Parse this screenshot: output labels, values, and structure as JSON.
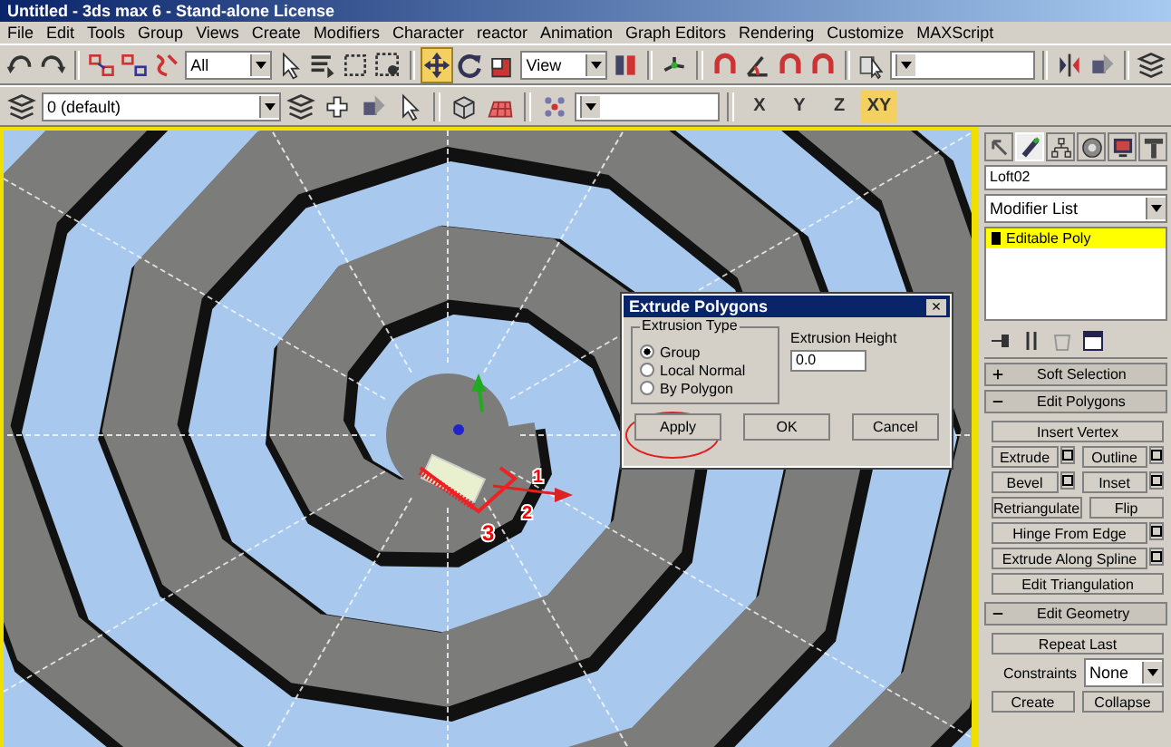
{
  "window": {
    "title": "Untitled - 3ds max 6 - Stand-alone License"
  },
  "menu": [
    "File",
    "Edit",
    "Tools",
    "Group",
    "Views",
    "Create",
    "Modifiers",
    "Character",
    "reactor",
    "Animation",
    "Graph Editors",
    "Rendering",
    "Customize",
    "MAXScript"
  ],
  "toolbar_1": [
    {
      "kind": "undo",
      "selected": false
    },
    {
      "kind": "redo",
      "selected": false
    },
    {
      "kind": "sep"
    },
    {
      "kind": "link",
      "selected": false
    },
    {
      "kind": "unlink",
      "selected": false
    },
    {
      "kind": "bind",
      "selected": false
    },
    {
      "kind": "dropdown",
      "value": "All"
    },
    {
      "kind": "select",
      "selected": false
    },
    {
      "kind": "list",
      "selected": false
    },
    {
      "kind": "region",
      "selected": false
    },
    {
      "kind": "window",
      "selected": false
    },
    {
      "kind": "sep"
    },
    {
      "kind": "move",
      "selected": true
    },
    {
      "kind": "rotate",
      "selected": false
    },
    {
      "kind": "scale",
      "selected": false
    },
    {
      "kind": "dropdown",
      "value": "View"
    },
    {
      "kind": "pivot",
      "selected": false
    },
    {
      "kind": "sep"
    },
    {
      "kind": "manipulate",
      "selected": false
    },
    {
      "kind": "sep"
    },
    {
      "kind": "magnet",
      "selected": false
    },
    {
      "kind": "angle",
      "selected": false
    },
    {
      "kind": "magnet",
      "selected": false
    },
    {
      "kind": "magnet",
      "selected": false
    },
    {
      "kind": "sep"
    },
    {
      "kind": "named",
      "selected": false
    },
    {
      "kind": "dropdown"
    },
    {
      "kind": "sep"
    },
    {
      "kind": "mirror",
      "selected": false
    },
    {
      "kind": "align",
      "selected": false
    },
    {
      "kind": "sep"
    },
    {
      "kind": "layers",
      "selected": false
    }
  ],
  "toolbar_2": [
    {
      "kind": "layers",
      "selected": false
    },
    {
      "kind": "dropdown",
      "value": "0 (default)"
    },
    {
      "kind": "layers",
      "selected": false
    },
    {
      "kind": "plus",
      "selected": false
    },
    {
      "kind": "align",
      "selected": false
    },
    {
      "kind": "select",
      "selected": false
    },
    {
      "kind": "sep"
    },
    {
      "kind": "teapot",
      "selected": false
    },
    {
      "kind": "grid",
      "selected": false
    },
    {
      "kind": "sep"
    },
    {
      "kind": "dots",
      "selected": false
    },
    {
      "kind": "dropdown"
    },
    {
      "kind": "sep"
    },
    {
      "kind": "axis",
      "label": "X",
      "selected": false
    },
    {
      "kind": "axis",
      "label": "Y",
      "selected": false
    },
    {
      "kind": "axis",
      "label": "Z",
      "selected": false
    },
    {
      "kind": "axis",
      "label": "XY",
      "selected": true
    }
  ],
  "viewport": {
    "gizmo_labels": [
      "1",
      "2",
      "3"
    ]
  },
  "dialog": {
    "title": "Extrude Polygons",
    "close": "×",
    "group_title": "Extrusion Type",
    "extrusion_types": [
      {
        "label": "Group",
        "selected": true
      },
      {
        "label": "Local Normal",
        "selected": false
      },
      {
        "label": "By Polygon",
        "selected": false
      }
    ],
    "height_label": "Extrusion Height",
    "height_value": "0.0",
    "buttons": [
      "Apply",
      "OK",
      "Cancel"
    ]
  },
  "command_panel": {
    "tabs": [
      {
        "kind": "create",
        "selected": false
      },
      {
        "kind": "modify",
        "selected": true
      },
      {
        "kind": "hierarchy",
        "selected": false
      },
      {
        "kind": "motion",
        "selected": false
      },
      {
        "kind": "display",
        "selected": false
      },
      {
        "kind": "utilities",
        "selected": false
      }
    ],
    "object_name": "Loft02",
    "modifier_list": "Modifier List",
    "stack": [
      {
        "label": "Editable Poly",
        "selected": true
      }
    ],
    "rollouts": [
      {
        "title": "Soft Selection",
        "expanded": false
      },
      {
        "title": "Edit Polygons",
        "expanded": true,
        "rows": [
          [
            {
              "label": "Insert Vertex",
              "settings": false
            }
          ],
          [
            {
              "label": "Extrude",
              "settings": true
            },
            {
              "label": "Outline",
              "settings": true
            }
          ],
          [
            {
              "label": "Bevel",
              "settings": true
            },
            {
              "label": "Inset",
              "settings": true
            }
          ],
          [
            {
              "label": "Retriangulate",
              "settings": false
            },
            {
              "label": "Flip",
              "settings": false
            }
          ],
          [
            {
              "label": "Hinge From Edge",
              "settings": true
            }
          ],
          [
            {
              "label": "Extrude Along Spline",
              "settings": true
            }
          ],
          [
            {
              "label": "Edit Triangulation",
              "settings": false
            }
          ]
        ]
      },
      {
        "title": "Edit Geometry",
        "expanded": true,
        "rows": [
          [
            {
              "label": "Repeat Last",
              "settings": false
            }
          ],
          [
            {
              "label": "Constraints",
              "kind": "label"
            },
            {
              "label": "None",
              "kind": "dropdown"
            }
          ],
          [
            {
              "label": "Create",
              "settings": false
            },
            {
              "label": "Collapse",
              "settings": false
            }
          ]
        ]
      }
    ]
  }
}
